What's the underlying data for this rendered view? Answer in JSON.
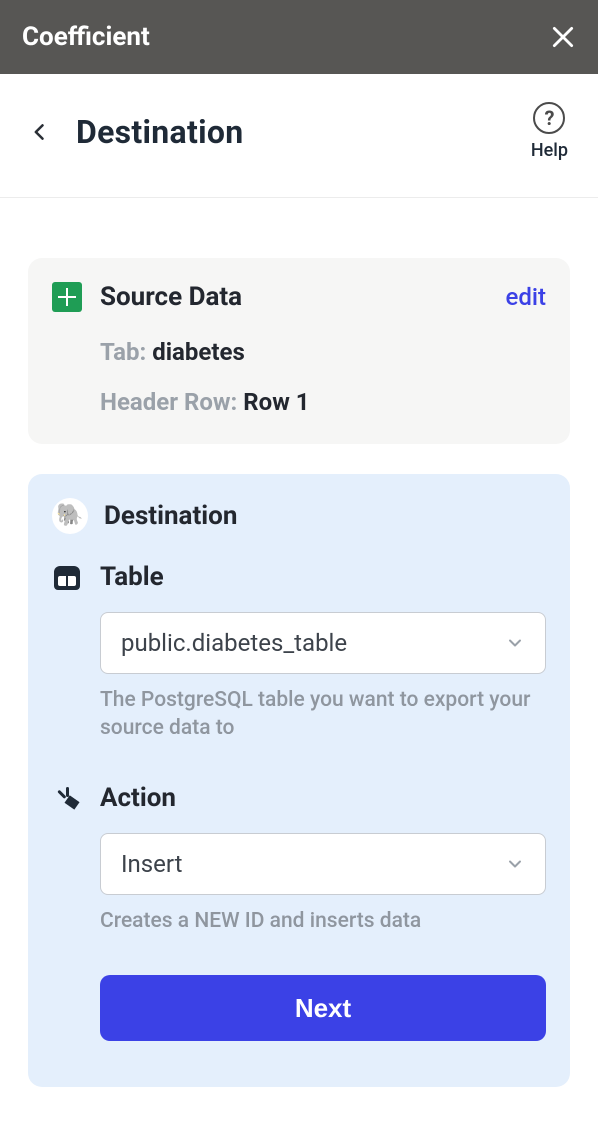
{
  "header": {
    "app_title": "Coefficient"
  },
  "page": {
    "title": "Destination",
    "help_label": "Help"
  },
  "source": {
    "title": "Source Data",
    "edit_label": "edit",
    "tab_label": "Tab:",
    "tab_value": "diabetes",
    "header_row_label": "Header Row:",
    "header_row_value": "Row 1"
  },
  "destination": {
    "title": "Destination",
    "table": {
      "label": "Table",
      "selected": "public.diabetes_table",
      "help": "The PostgreSQL table you want to export your source data to"
    },
    "action": {
      "label": "Action",
      "selected": "Insert",
      "help": "Creates a NEW ID and inserts data"
    },
    "next_label": "Next"
  }
}
